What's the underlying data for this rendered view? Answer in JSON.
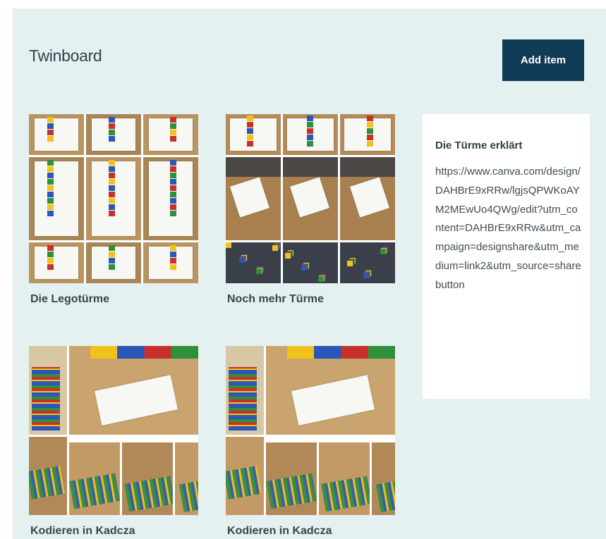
{
  "board": {
    "title": "Twinboard",
    "add_button": "Add item"
  },
  "cards": [
    {
      "caption": "Die Legotürme"
    },
    {
      "caption": "Noch mehr Türme"
    },
    {
      "caption": "Kodieren in Kadcza"
    },
    {
      "caption": "Kodieren in Kadcza"
    }
  ],
  "note": {
    "title": "Die Türme erklärt",
    "body": "https://www.canva.com/design/DAHBrE9xRRw/lgjsQPWKoAYM2MEwUo4QWg/edit?utm_content=DAHBrE9xRRw&utm_campaign=designshare&utm_medium=link2&utm_source=sharebutton"
  },
  "colors": {
    "board_bg": "#e5f1f1",
    "button_bg": "#0f3b57",
    "floor": "#b48a5a",
    "lego_blue": "#2a57b8",
    "lego_yellow": "#f1c21b",
    "lego_red": "#c8312b",
    "lego_green": "#2f8f3c"
  }
}
